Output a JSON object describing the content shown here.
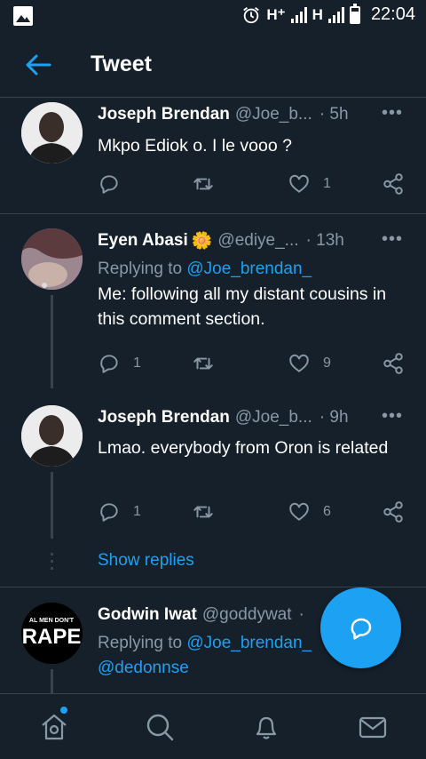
{
  "status_bar": {
    "network1": "H⁺",
    "network2": "H",
    "time": "22:04"
  },
  "header": {
    "title": "Tweet"
  },
  "tweets": [
    {
      "name": "Joseph Brendan",
      "handle": "@Joe_b...",
      "time": "· 5h",
      "text": "Mkpo Ediok o. I le vooo ?",
      "replies": "",
      "likes": "1"
    },
    {
      "name": "Eyen Abasi",
      "emoji": "🌼",
      "handle": "@ediye_...",
      "time": "· 13h",
      "replying_label": "Replying to",
      "replying_to": "@Joe_brendan_",
      "text": "Me: following all my distant cousins in this comment section.",
      "replies": "1",
      "likes": "9"
    },
    {
      "name": "Joseph Brendan",
      "handle": "@Joe_b...",
      "time": "· 9h",
      "text": "Lmao. everybody from Oron is related",
      "replies": "1",
      "likes": "6"
    },
    {
      "name": "Godwin Iwat",
      "handle": "@goddywat",
      "time": "·",
      "replying_label": "Replying to",
      "replying_to": "@Joe_brendan_",
      "replying_to2": "@dedonnse",
      "avatar_text_top": "AL MEN DON'T",
      "avatar_text_main": "RAPE"
    }
  ],
  "show_replies": "Show replies",
  "more_label": "•••",
  "colors": {
    "background": "#15202b",
    "accent": "#1da1f2",
    "muted": "#8899a6",
    "divider": "#38444d"
  },
  "icons": [
    "back-arrow-icon",
    "reply-icon",
    "retweet-icon",
    "like-icon",
    "share-icon",
    "compose-reply-icon",
    "home-icon",
    "search-icon",
    "bell-icon",
    "mail-icon"
  ]
}
